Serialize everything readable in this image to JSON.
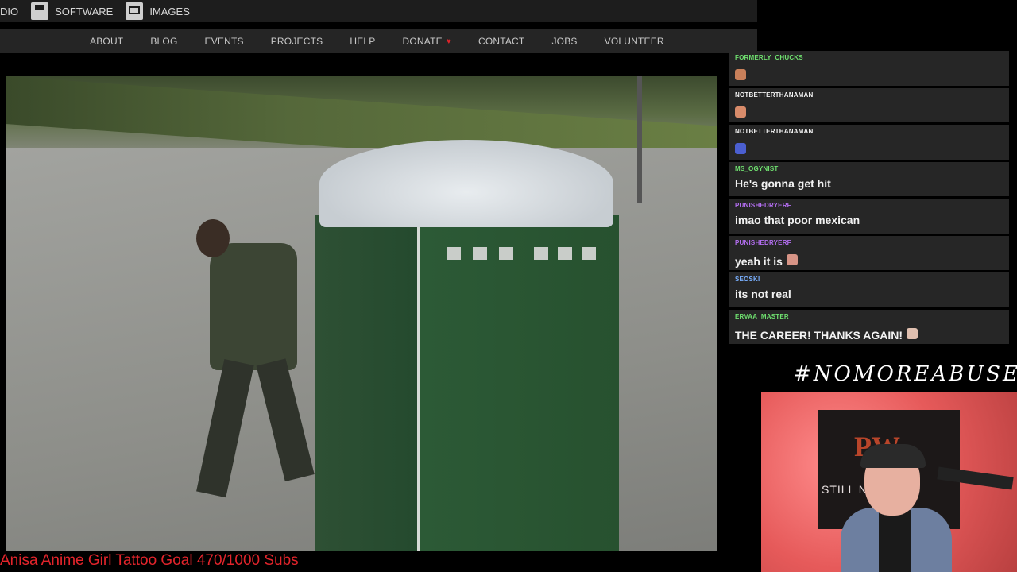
{
  "topbar": {
    "partial_label": "DIO",
    "software": "SOFTWARE",
    "images": "IMAGES"
  },
  "nav": [
    "ABOUT",
    "BLOG",
    "EVENTS",
    "PROJECTS",
    "HELP",
    "DONATE",
    "CONTACT",
    "JOBS",
    "VOLUNTEER"
  ],
  "chat": [
    {
      "user": "FORMERLY_CHUCKS",
      "color": "#6fe06f",
      "text": "",
      "emote": "#c9805a"
    },
    {
      "user": "NOTBETTERTHANAMAN",
      "color": "#f2f2f2",
      "text": "",
      "emote": "#d88b6a"
    },
    {
      "user": "NOTBETTERTHANAMAN",
      "color": "#f2f2f2",
      "text": "",
      "emote": "#4b5fd0"
    },
    {
      "user": "MS_OGYNIST",
      "color": "#6fe06f",
      "text": "He's gonna get hit",
      "emote": ""
    },
    {
      "user": "PUNISHEDRYERF",
      "color": "#b36ef0",
      "text": "imao that poor mexican",
      "emote": ""
    },
    {
      "user": "PUNISHEDRYERF",
      "color": "#b36ef0",
      "text": "yeah it is",
      "emote": "#d79486"
    },
    {
      "user": "SEOSKI",
      "color": "#7ab0ff",
      "text": "its not real",
      "emote": ""
    },
    {
      "user": "ERVAA_MASTER",
      "color": "#6fe06f",
      "text": "THE CAREER! THANKS AGAIN!",
      "emote": "#e0c0b0"
    }
  ],
  "hashtag": "#NOMOREABUSE",
  "banner": {
    "logo": "PW",
    "text": "STILL NOT"
  },
  "goal": "Anisa Anime Girl Tattoo Goal 470/1000 Subs"
}
